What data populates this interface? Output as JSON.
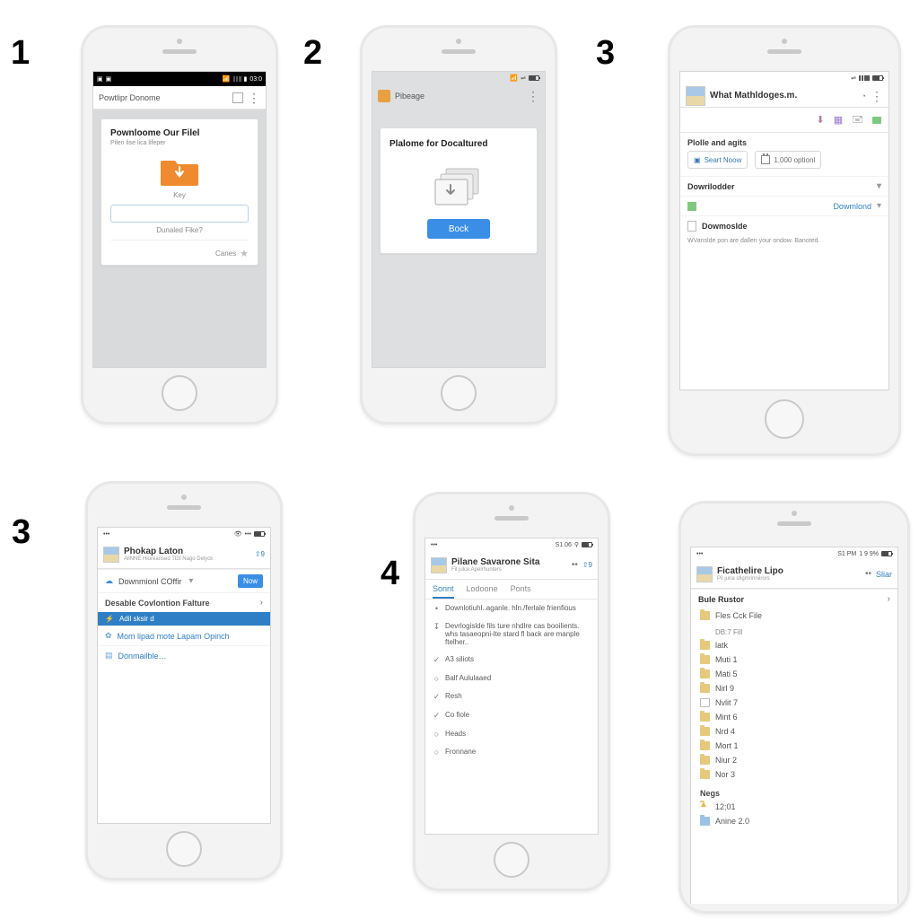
{
  "steps": {
    "s1": "1",
    "s2": "2",
    "s3": "3",
    "s4": "4"
  },
  "p1": {
    "status": {
      "time": "03:0"
    },
    "header": "Powtlipr Donome",
    "card_title": "Pownloome Our Filel",
    "card_sub": "Pilen lise lica lifeper",
    "field_label": "Key",
    "help": "Dunaled Fike?",
    "cancel": "Canes"
  },
  "p2": {
    "header": "Pibeage",
    "card_title": "Plalome for Docaltured",
    "back": "Bock"
  },
  "p3": {
    "header": "What Mathldoges.m.",
    "section": "Plolle and agits",
    "btn1": "Seart Noow",
    "btn2": "1.000 optionl",
    "acc1": "Dowrilodder",
    "link": "Dowmlond",
    "acc2": "Dowmoslde",
    "acc2_sub": "WVanslde pon are dallen your ondow. Banoted."
  },
  "p4": {
    "header_title": "Phokap Laton",
    "header_sub": "AllNNE Hioreansed TEll Nago Delyck",
    "row_download": "Downmionl COffir",
    "new": "Now",
    "row_disable": "Desable Covlontion Falture",
    "row_add": "Adil sksir d",
    "row_more": "Mom lipad mote Lapam Opinch",
    "row_down": "Donmailble…"
  },
  "p5": {
    "status_time": "S1.06",
    "header_title": "Pilane Savarone Sita",
    "header_sub": "Fil julce Apelrhunters",
    "tabs": [
      "Sonnt",
      "Lodoone",
      "Ponts"
    ],
    "items": [
      "Downlotiuhl..aganle. hln./ferlale frienfious",
      "Devrlogislde fils ture nhdlre cas booilients. whs tasaeopni-lte stard fl back are manple ftelher..",
      "A3 siliots",
      "Balf Aululaaed",
      "Resh",
      "Co fiole",
      "Heads",
      "Fronnane"
    ]
  },
  "p6": {
    "status_time": "S1 PM",
    "status_right": "1 9 9%",
    "header_title": "Ficathelire Lipo",
    "header_sub": "Pil juna sfigmrinniirors",
    "share": "Sliar",
    "section": "Bule Rustor",
    "files": [
      "Fles Cck File",
      "latk",
      "Muti 1",
      "Mati 5",
      "Nirl 9",
      "Nvlit 7",
      "Mint 6",
      "Nrd 4",
      "Mort 1",
      "Niur 2",
      "Nor 3"
    ],
    "file0_sub": "DB:7 Fill",
    "negs": "Negs",
    "neg1": "12;01",
    "neg2": "Anine 2.0"
  }
}
